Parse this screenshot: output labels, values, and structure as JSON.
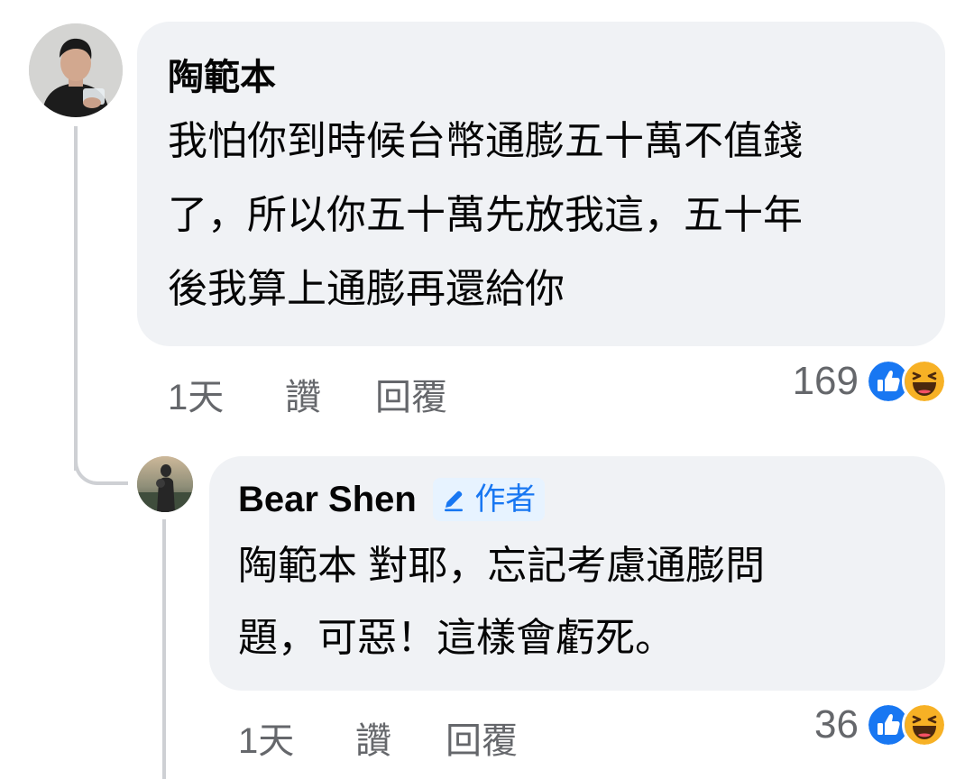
{
  "comments": [
    {
      "author": "陶範本",
      "text_lines": [
        "我怕你到時候台幣通膨五十萬不值錢",
        "了，所以你五十萬先放我這，五十年",
        "後我算上通膨再還給你"
      ],
      "time": "1天",
      "like_label": "讚",
      "reply_label": "回覆",
      "reaction_count": "169",
      "reactions": [
        "like-icon",
        "haha-icon"
      ]
    },
    {
      "author": "Bear Shen",
      "badge_label": "作者",
      "badge_icon": "pencil-icon",
      "text_lines": [
        "陶範本 對耶，忘記考慮通膨問",
        "題，可惡！這樣會虧死。"
      ],
      "time": "1天",
      "like_label": "讚",
      "reply_label": "回覆",
      "reaction_count": "36",
      "reactions": [
        "like-icon",
        "haha-icon"
      ]
    }
  ],
  "colors": {
    "bubble": "#f0f2f5",
    "secondary_text": "#65676b",
    "like_blue": "#1877f2",
    "haha_yellow": "#f7b125",
    "thread_line": "#ced0d4"
  }
}
